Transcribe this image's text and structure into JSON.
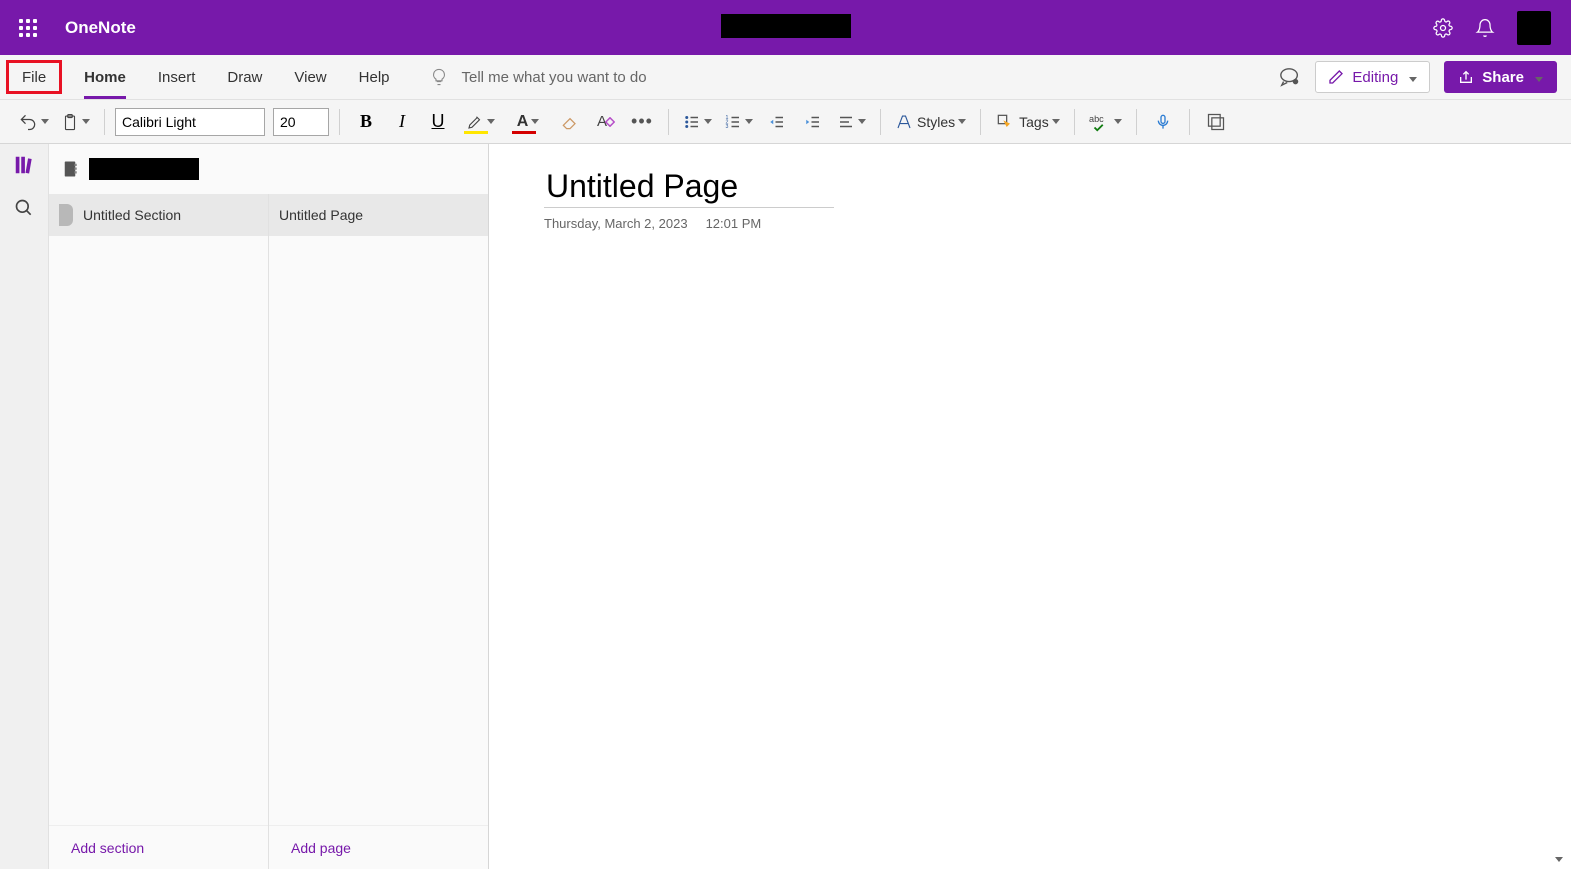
{
  "app": {
    "name": "OneNote"
  },
  "menu": {
    "file": "File",
    "tabs": [
      "Home",
      "Insert",
      "Draw",
      "View",
      "Help"
    ],
    "active_tab": "Home",
    "tellme_placeholder": "Tell me what you want to do",
    "editing": "Editing",
    "share": "Share"
  },
  "ribbon": {
    "font_name": "Calibri Light",
    "font_size": "20",
    "styles_label": "Styles",
    "tags_label": "Tags"
  },
  "nav": {
    "section": "Untitled Section",
    "page": "Untitled Page",
    "add_section": "Add section",
    "add_page": "Add page"
  },
  "page": {
    "title": "Untitled Page",
    "date": "Thursday, March 2, 2023",
    "time": "12:01 PM"
  }
}
